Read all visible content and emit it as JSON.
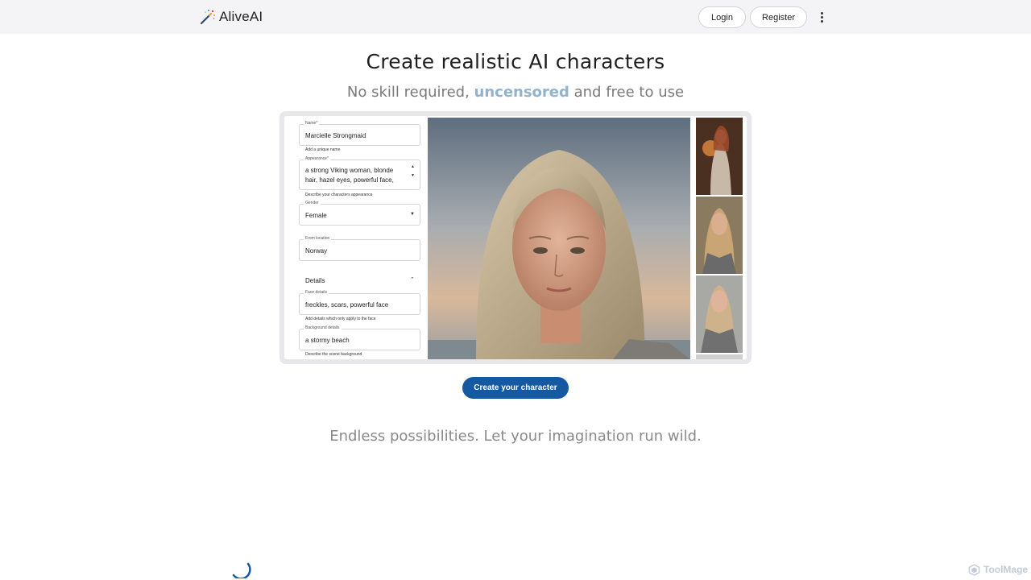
{
  "header": {
    "brand": "AliveAI",
    "login_label": "Login",
    "register_label": "Register"
  },
  "hero": {
    "title": "Create realistic AI characters",
    "subtitle_pre": "No skill required, ",
    "subtitle_highlight": "uncensored",
    "subtitle_post": " and free to use"
  },
  "preview_form": {
    "name_label": "Name*",
    "name_value": "Marcielle Strongmaid",
    "name_help": "Add a unique name",
    "appearance_label": "Appearance*",
    "appearance_line1": "a strong Viking woman, blonde",
    "appearance_line2": "hair, hazel eyes, powerful face,",
    "appearance_help": "Describe your characters appearance",
    "gender_label": "Gender",
    "gender_value": "Female",
    "location_label": "From location",
    "location_value": "Norway",
    "details_label": "Details",
    "face_label": "Face details",
    "face_value": "freckles, scars, powerful face",
    "face_help": "Add details which only apply to the face",
    "background_label": "Background details",
    "background_value": "a stormy beach",
    "background_help": "Describe the scene background"
  },
  "cta_label": "Create your character",
  "tagline": "Endless possibilities. Let your imagination run wild.",
  "watermark": "ToolMage",
  "colors": {
    "header_bg": "#f4f4f6",
    "accent": "#1659a3",
    "highlight": "#8fb3d0"
  },
  "icons": {
    "logo": "magic-wand-icon",
    "menu": "more-vertical-icon",
    "loader": "spinner-icon",
    "watermark": "toolmage-logo-icon"
  }
}
